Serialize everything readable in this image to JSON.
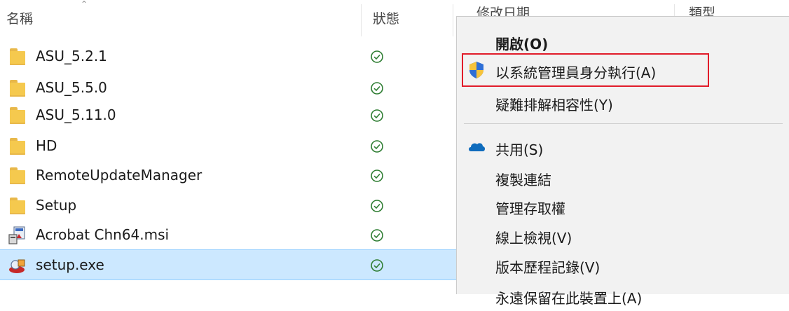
{
  "columns": {
    "name": "名稱",
    "status": "狀態",
    "modified": "修改日期",
    "type": "類型"
  },
  "files": [
    {
      "name": "ASU_5.2.1",
      "icon": "folder-icon",
      "status": "synced"
    },
    {
      "name": "ASU_5.5.0",
      "icon": "folder-icon",
      "status": "synced"
    },
    {
      "name": "ASU_5.11.0",
      "icon": "folder-icon",
      "status": "synced"
    },
    {
      "name": "HD",
      "icon": "folder-icon",
      "status": "synced"
    },
    {
      "name": "RemoteUpdateManager",
      "icon": "folder-icon",
      "status": "synced"
    },
    {
      "name": "Setup",
      "icon": "folder-icon",
      "status": "synced"
    },
    {
      "name": "Acrobat Chn64.msi",
      "icon": "msi-installer-icon",
      "status": "synced"
    },
    {
      "name": "setup.exe",
      "icon": "setup-exe-icon",
      "status": "synced",
      "selected": true
    }
  ],
  "context_menu": {
    "open": "開啟(O)",
    "run_as_admin": "以系統管理員身分執行(A)",
    "troubleshoot": "疑難排解相容性(Y)",
    "share": "共用(S)",
    "copy_link": "複製連結",
    "manage_access": "管理存取權",
    "view_online": "線上檢視(V)",
    "version_history": "版本歷程記錄(V)",
    "always_keep": "永遠保留在此裝置上(A)"
  },
  "colors": {
    "selection_bg": "#cce8ff",
    "menu_bg": "#f2f2f2",
    "highlight": "#e11c2a",
    "status_green": "#2e7d32",
    "onedrive_blue": "#0f6cbd"
  }
}
